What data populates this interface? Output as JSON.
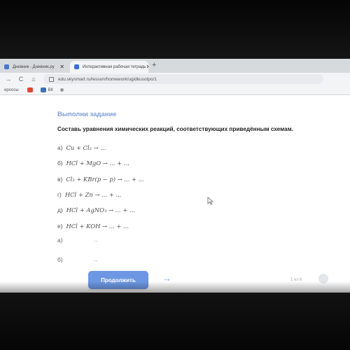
{
  "browser": {
    "tabs": [
      {
        "label": "Дневник - Дневник.ру",
        "active": false,
        "favicon_color": "#4a79c9"
      },
      {
        "label": "Интерактивная рабочая тетрадь",
        "active": true,
        "favicon_color": "#3b6fd8"
      }
    ],
    "tab_close": "✕",
    "new_tab": "+",
    "nav": {
      "back": "→",
      "reload": "C",
      "home": "⌂"
    },
    "url": "edu.skysmart.ru/lesson/homework/ugidkusotpo/1",
    "bookmarks": [
      {
        "label": "ероосы",
        "badge_color": "#cccccc"
      },
      {
        "label": "",
        "badge_color": "#e0452f"
      },
      {
        "label": "ВК",
        "badge_color": "#3f6fb8"
      },
      {
        "label": "",
        "badge_color": "#999999"
      }
    ]
  },
  "task": {
    "title": "Выполни задание",
    "instruction": "Составь уравнения химических реакций, соответствующих приведённым схемам.",
    "reactions": [
      {
        "label": "а)",
        "scheme": "Cu + Cl₂ → ..."
      },
      {
        "label": "б)",
        "scheme": "HCl + MgO → ... + ..."
      },
      {
        "label": "в)",
        "scheme": "Cl₂ + KBr(p − p) → ... + ..."
      },
      {
        "label": "г)",
        "scheme": "HCl + Zn → ... + ..."
      },
      {
        "label": "д)",
        "scheme": "HCl + AgNO₃ → ... + ..."
      },
      {
        "label": "е)",
        "scheme": "HCl + KOH → ... + ..."
      }
    ],
    "answers": [
      {
        "label": "а)",
        "arrow": "→"
      },
      {
        "label": "б)",
        "arrow": "→"
      }
    ]
  },
  "footer": {
    "continue_label": "Продолжить",
    "next_arrow": "→",
    "pager": "1 из 6"
  },
  "colors": {
    "accent": "#6d97e2",
    "title": "#7f9fd8"
  }
}
